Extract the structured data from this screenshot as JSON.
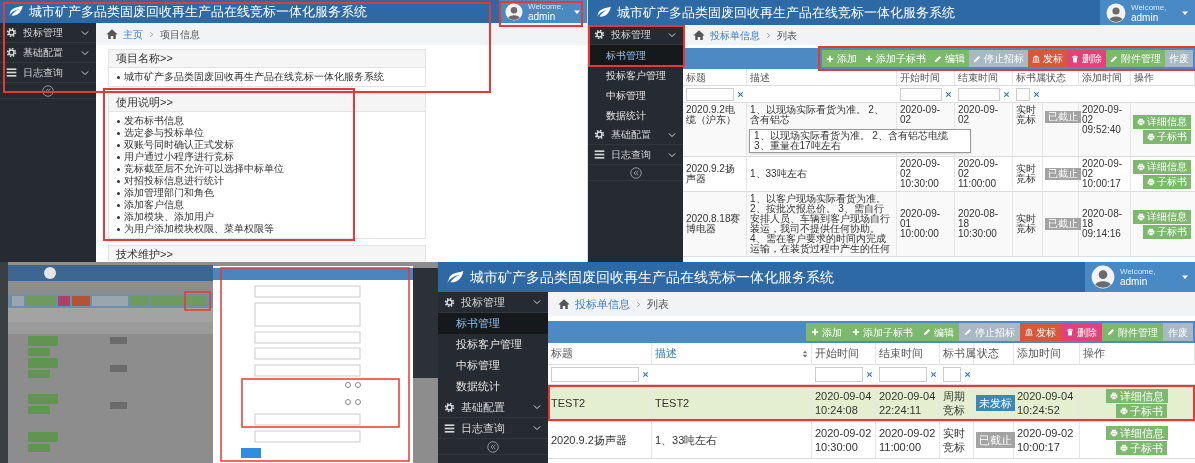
{
  "screens": [
    {
      "kind": "home",
      "header": {
        "title": "城市矿产多品类固废回收再生产品在线竞标一体化服务系统",
        "welcome": "Welcome,",
        "user": "admin"
      },
      "sidebar": [
        {
          "label": "投标管理"
        },
        {
          "label": "基础配置"
        },
        {
          "label": "日志查询"
        }
      ],
      "breadcrumb": [
        {
          "label": "主页",
          "link": true
        },
        {
          "label": "项目信息",
          "link": false
        }
      ],
      "sections": [
        {
          "title": "项目名称>>",
          "items": [
            "城市矿产多品类固废回收再生产品在线竞标一体化服务系统"
          ]
        },
        {
          "title": "使用说明>>",
          "items": [
            "发布标书信息",
            "选定参与投标单位",
            "双账号同时确认正式发标",
            "用户通过小程序进行竞标",
            "竞标截至后不允许可以选择中标单位",
            "对招投标信息进行统计",
            "添加管理部门和角色",
            "添加客户信息",
            "添加模块、添加用户",
            "为用户添加模块权限、菜单权限等"
          ]
        },
        {
          "title": "技术维护>>"
        }
      ]
    },
    {
      "kind": "list",
      "header": {
        "title": "城市矿产多品类固废回收再生产品在线竞标一体化服务系统",
        "welcome": "Welcome,",
        "user": "admin"
      },
      "sidebar": [
        {
          "label": "投标管理",
          "children": [
            {
              "label": "标书管理",
              "selected": true
            },
            {
              "label": "投标客户管理",
              "selected": false
            },
            {
              "label": "中标管理",
              "selected": false
            },
            {
              "label": "数据统计",
              "selected": false
            }
          ]
        },
        {
          "label": "基础配置"
        },
        {
          "label": "日志查询"
        }
      ],
      "breadcrumb": [
        {
          "label": "投标单信息",
          "link": true
        },
        {
          "label": "列表",
          "link": false
        }
      ],
      "toolbar": [
        {
          "label": "添加",
          "color": "#7db96c"
        },
        {
          "label": "添加子标书",
          "color": "#7db96c"
        },
        {
          "label": "编辑",
          "color": "#7db96c"
        },
        {
          "label": "停止招标",
          "color": "#a8b8c4"
        },
        {
          "label": "发标",
          "color": "#d8573a"
        },
        {
          "label": "删除",
          "color": "#df437b"
        },
        {
          "label": "附件管理",
          "color": "#7db96c"
        },
        {
          "label": "作废",
          "color": "#a8b8c4"
        }
      ],
      "columns": [
        {
          "label": "标题",
          "filter": true,
          "sorted": false
        },
        {
          "label": "描述",
          "filter": false,
          "sorted": false
        },
        {
          "label": "开始时间",
          "filter": true,
          "sorted": false
        },
        {
          "label": "结束时间",
          "filter": true,
          "sorted": false
        },
        {
          "label": "标书属",
          "filter": true,
          "sorted": false
        },
        {
          "label": "状态",
          "filter": false,
          "sorted": false
        },
        {
          "label": "添加时间",
          "filter": false,
          "sorted": false
        },
        {
          "label": "操作",
          "filter": false,
          "sorted": false
        }
      ],
      "rows": [
        {
          "selected": false,
          "title": "2020.9.2电缆（沪东）",
          "description": "1、以现场实际看货为准。 2、含有铝芯",
          "start": "2020-09-02",
          "end": "2020-09-02",
          "attribute": "实时竞标",
          "status": {
            "label": "已截止",
            "color": "#a3a3a3"
          },
          "added": "2020-09-02 09:52:40",
          "actions": [
            "详细信息",
            "子标书"
          ],
          "tooltip": "1、以现场实际看货为准。 2、含有铝芯电缆 3、重量在17吨左右"
        },
        {
          "selected": false,
          "title": "2020.9.2扬声器",
          "description": "1、33吨左右",
          "start": "2020-09-02 10:30:00",
          "end": "2020-09-02 11:00:00",
          "attribute": "实时竞标",
          "status": {
            "label": "已截止",
            "color": "#a3a3a3"
          },
          "added": "2020-09-02 10:00:17",
          "actions": [
            "详细信息",
            "子标书"
          ]
        },
        {
          "selected": false,
          "title": "2020.8.18赛博电器",
          "description": "1、以客户现场实际看货为准。 2、按批次报总价。 3、需自行安排人员、车辆到客户现场自行装运，我司不提供任何协助。 4、需在客户要求的时间内完成运输，在装货过程中产生的任何",
          "start": "2020-09-01 10:00:00",
          "end": "2020-08-18 10:30:00",
          "attribute": "实时竞标",
          "status": {
            "label": "已截止",
            "color": "#a3a3a3"
          },
          "added": "2020-08-18 09:14:16",
          "actions": [
            "详细信息",
            "子标书"
          ]
        }
      ]
    },
    {
      "kind": "mirrored_form"
    },
    {
      "kind": "list",
      "header": {
        "title": "城市矿产多品类固废回收再生产品在线竞标一体化服务系统",
        "welcome": "Welcome,",
        "user": "admin"
      },
      "sidebar": [
        {
          "label": "投标管理",
          "children": [
            {
              "label": "标书管理",
              "selected": true
            },
            {
              "label": "投标客户管理",
              "selected": false
            },
            {
              "label": "中标管理",
              "selected": false
            },
            {
              "label": "数据统计",
              "selected": false
            }
          ]
        },
        {
          "label": "基础配置"
        },
        {
          "label": "日志查询"
        }
      ],
      "breadcrumb": [
        {
          "label": "投标单信息",
          "link": true
        },
        {
          "label": "列表",
          "link": false
        }
      ],
      "toolbar": [
        {
          "label": "添加",
          "color": "#7db96c"
        },
        {
          "label": "添加子标书",
          "color": "#7db96c"
        },
        {
          "label": "编辑",
          "color": "#7db96c"
        },
        {
          "label": "停止招标",
          "color": "#a8b8c4"
        },
        {
          "label": "发标",
          "color": "#d8573a"
        },
        {
          "label": "删除",
          "color": "#df437b"
        },
        {
          "label": "附件管理",
          "color": "#7db96c"
        },
        {
          "label": "作废",
          "color": "#a8b8c4"
        }
      ],
      "columns": [
        {
          "label": "标题",
          "filter": true,
          "sorted": false
        },
        {
          "label": "描述",
          "filter": false,
          "sorted": true
        },
        {
          "label": "开始时间",
          "filter": true,
          "sorted": false
        },
        {
          "label": "结束时间",
          "filter": true,
          "sorted": false
        },
        {
          "label": "标书属",
          "filter": true,
          "sorted": false
        },
        {
          "label": "状态",
          "filter": false,
          "sorted": false
        },
        {
          "label": "添加时间",
          "filter": false,
          "sorted": false
        },
        {
          "label": "操作",
          "filter": false,
          "sorted": false
        }
      ],
      "rows": [
        {
          "selected": true,
          "title": "TEST2",
          "description": "TEST2",
          "start": "2020-09-04 10:24:08",
          "end": "2020-09-04 22:24:11",
          "attribute": "周期竞标",
          "status": {
            "label": "未发标",
            "color": "#3b87b8"
          },
          "added": "2020-09-04 10:24:52",
          "actions": [
            "详细信息",
            "子标书"
          ]
        },
        {
          "selected": false,
          "title": "2020.9.2扬声器",
          "description": "1、33吨左右",
          "start": "2020-09-02 10:30:00",
          "end": "2020-09-02 11:00:00",
          "attribute": "实时竞标",
          "status": {
            "label": "已截止",
            "color": "#a3a3a3"
          },
          "added": "2020-09-02 10:00:17",
          "actions": [
            "详细信息",
            "子标书"
          ]
        }
      ]
    }
  ]
}
